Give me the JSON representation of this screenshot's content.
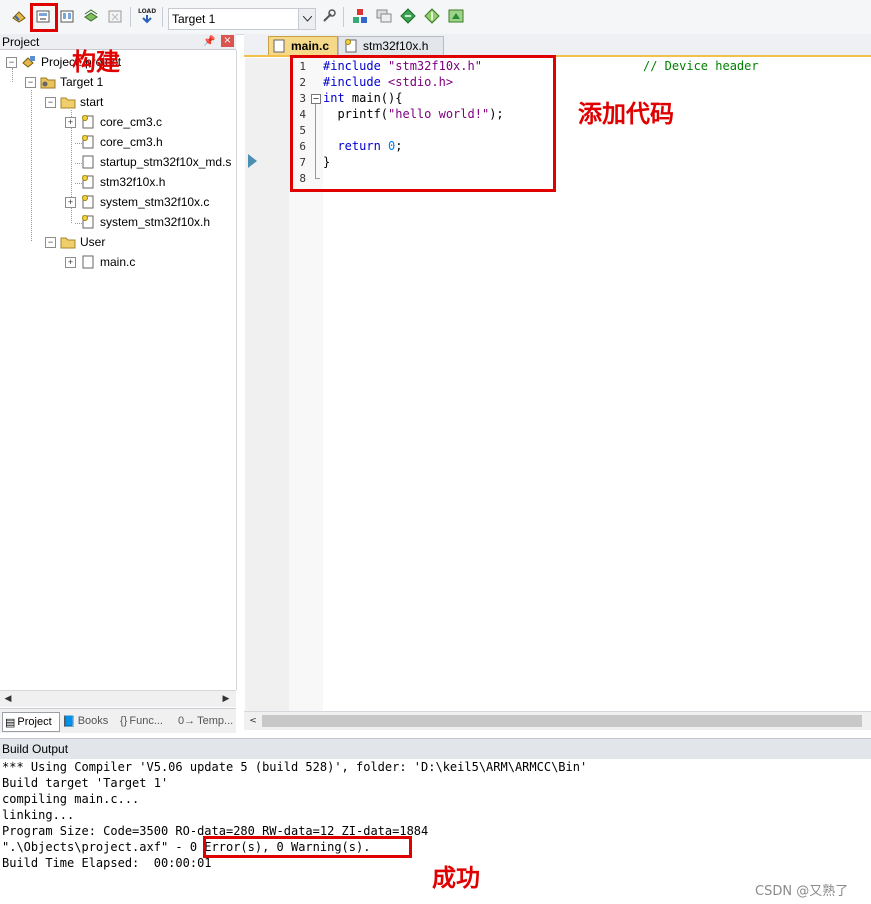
{
  "toolbar": {
    "target_value": "Target 1",
    "load_label": "LOAD"
  },
  "project_panel": {
    "title": "Project",
    "close": "×",
    "tree": {
      "root": "Project: project",
      "target": "Target 1",
      "group_start": "start",
      "files_start": [
        "core_cm3.c",
        "core_cm3.h",
        "startup_stm32f10x_md.s",
        "stm32f10x.h",
        "system_stm32f10x.c",
        "system_stm32f10x.h"
      ],
      "group_user": "User",
      "files_user": [
        "main.c"
      ]
    },
    "bottom_tabs": [
      "Project",
      "Books",
      "Func...",
      "Temp..."
    ]
  },
  "editor": {
    "tabs": [
      "main.c",
      "stm32f10x.h"
    ],
    "line_numbers": [
      "1",
      "2",
      "3",
      "4",
      "5",
      "6",
      "7",
      "8"
    ],
    "code": {
      "l1_pp": "#include",
      "l1_str": " \"stm32f10x.h\"",
      "l1_cm": "// Device header",
      "l2_pp": "#include",
      "l2_str": " <stdio.h>",
      "l3_kw": "int",
      "l3_rest": " main(){",
      "l4_fn": "  printf(",
      "l4_str": "\"hello world!\"",
      "l4_end": ");",
      "l6_kw": "  return",
      "l6_num": " 0",
      "l6_end": ";",
      "l7": "}"
    }
  },
  "build_output": {
    "title": "Build Output",
    "lines": [
      "*** Using Compiler 'V5.06 update 5 (build 528)', folder: 'D:\\keil5\\ARM\\ARMCC\\Bin'",
      "Build target 'Target 1'",
      "compiling main.c...",
      "linking...",
      "Program Size: Code=3500 RO-data=280 RW-data=12 ZI-data=1884",
      "\".\\Objects\\project.axf\" - 0 Error(s), 0 Warning(s).",
      "Build Time Elapsed:  00:00:01"
    ]
  },
  "annotations": {
    "build": "构建",
    "add_code": "添加代码",
    "success": "成功"
  },
  "watermark": "CSDN @又熟了",
  "colors": {
    "annotation_red": "#e00000",
    "tab_active": "#f6d889",
    "keyword_blue": "#0000d0",
    "string_purple": "#800080",
    "comment_green": "#008000"
  }
}
